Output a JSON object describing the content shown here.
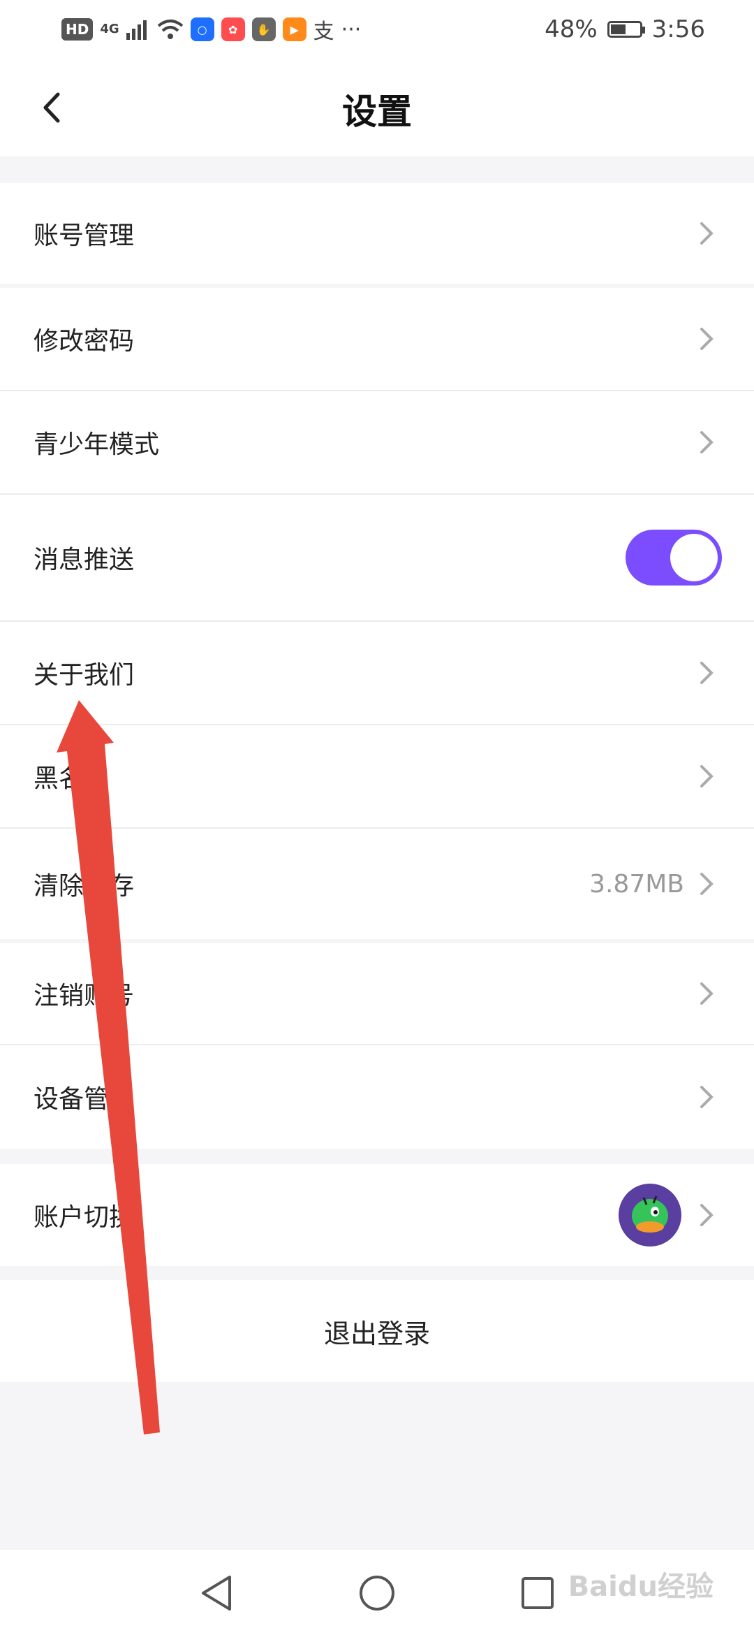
{
  "status_bar": {
    "hd_badge": "HD",
    "network": "4G",
    "battery_percent": "48%",
    "time": "3:56",
    "notification_icons": [
      "bulb-icon",
      "huawei-icon",
      "hand-icon",
      "video-icon",
      "alipay-icon",
      "more-icon"
    ]
  },
  "header": {
    "title": "设置"
  },
  "settings": {
    "account_manage": "账号管理",
    "change_password": "修改密码",
    "teen_mode": "青少年模式",
    "push_notifications": "消息推送",
    "push_enabled": true,
    "about_us": "关于我们",
    "blacklist": "黑名单",
    "clear_cache": "清除缓存",
    "cache_size": "3.87MB",
    "cancel_account": "注销账号",
    "device_manage": "设备管理",
    "switch_account": "账户切换"
  },
  "logout": {
    "label": "退出登录"
  },
  "colors": {
    "accent": "#7c4dff",
    "annotation_arrow": "#e8483b"
  },
  "watermark": {
    "text": "Baidu经验"
  }
}
